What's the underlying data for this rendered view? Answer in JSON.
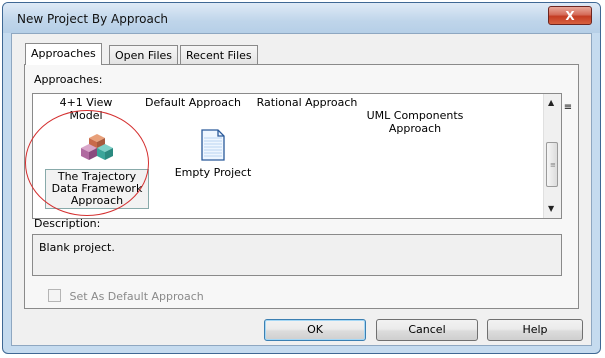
{
  "window": {
    "title": "New Project By Approach",
    "close_glyph": "X"
  },
  "tabs": [
    {
      "label": "Approaches",
      "active": true
    },
    {
      "label": "Open Files",
      "active": false
    },
    {
      "label": "Recent Files",
      "active": false
    }
  ],
  "approaches_label": "Approaches:",
  "view_toggle": {
    "large_icons_glyph": "▪▪\n▪▪",
    "list_glyph": "::-"
  },
  "approach_columns": [
    "4+1 View Model",
    "Default Approach",
    "Rational Approach",
    "UML Components\nApproach"
  ],
  "approach_items": [
    {
      "label": "The Trajectory\nData Framework\nApproach",
      "icon": "cubes-icon",
      "selected": true
    },
    {
      "label": "Empty Project",
      "icon": "blank-document-icon",
      "selected": false
    }
  ],
  "description_label": "Description:",
  "description_text": "Blank project.",
  "set_default_label": "Set As Default Approach",
  "buttons": {
    "ok": "OK",
    "cancel": "Cancel",
    "help": "Help"
  },
  "colors": {
    "annotation": "#d43030",
    "close_button": "#c43c22"
  }
}
